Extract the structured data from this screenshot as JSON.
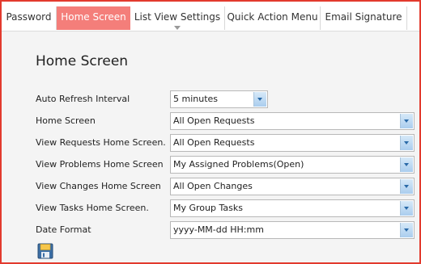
{
  "tabs": [
    {
      "label": "Password"
    },
    {
      "label": "Home Screen"
    },
    {
      "label": "List View Settings"
    },
    {
      "label": "Quick Action Menu"
    },
    {
      "label": "Email Signature"
    }
  ],
  "active_tab": "Home Screen",
  "colors": {
    "frame_border": "#e23a2e",
    "active_tab": "#f47e7a"
  },
  "page_title": "Home Screen",
  "fields": [
    {
      "label": "Auto Refresh Interval",
      "value": "5 minutes"
    },
    {
      "label": "Home Screen",
      "value": "All Open Requests"
    },
    {
      "label": "View Requests Home Screen.",
      "value": "All Open Requests"
    },
    {
      "label": "View Problems Home Screen",
      "value": "My Assigned Problems(Open)"
    },
    {
      "label": "View Changes Home Screen",
      "value": "All Open Changes"
    },
    {
      "label": "View Tasks Home Screen.",
      "value": "My Group Tasks"
    },
    {
      "label": "Date Format",
      "value": "yyyy-MM-dd HH:mm"
    }
  ],
  "save_icon": "floppy-disk-icon"
}
